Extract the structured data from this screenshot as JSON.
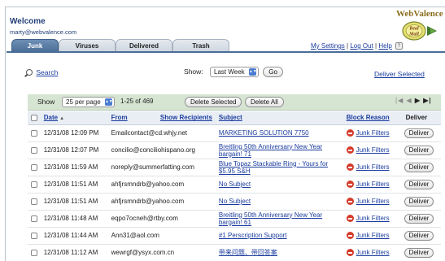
{
  "header": {
    "welcome": "Welcome",
    "email": "marty@webvalence.com",
    "logo_brand": "WebValence",
    "logo_product": "Real Mail"
  },
  "tabs": [
    {
      "label": "Junk",
      "active": true
    },
    {
      "label": "Viruses",
      "active": false
    },
    {
      "label": "Delivered",
      "active": false
    },
    {
      "label": "Trash",
      "active": false
    }
  ],
  "top_links": {
    "settings": "My Settings",
    "logout": "Log Out",
    "help": "Help",
    "help_glyph": "?"
  },
  "search": {
    "label": "Search"
  },
  "show": {
    "label": "Show:",
    "period": "Last Week",
    "go": "Go"
  },
  "deliver_selected": "Deliver Selected",
  "pager": {
    "show_label": "Show",
    "per_page": "25 per page",
    "range": "1-25 of 469",
    "delete_selected": "Delete Selected",
    "delete_all": "Delete All",
    "nav_first": "|◀",
    "nav_prev": "◀",
    "nav_next": "▶",
    "nav_last": "▶|"
  },
  "table": {
    "columns": {
      "date": "Date",
      "from": "From",
      "show_recipients": "Show Recipients",
      "subject": "Subject",
      "block_reason": "Block Reason",
      "deliver": "Deliver"
    },
    "rows": [
      {
        "date": "12/31/08 12:09 PM",
        "from": "Emailcontact@cd.whjy.net",
        "subject": "MARKETING SOLUTION   7750",
        "reason": "Junk Filters",
        "action": "Deliver"
      },
      {
        "date": "12/31/08 12:07 PM",
        "from": "concilio@conciliohispano.org",
        "subject": "Breitling 50th Anniversary New Year bargain! 71",
        "reason": "Junk Filters",
        "action": "Deliver"
      },
      {
        "date": "12/31/08 11:59 AM",
        "from": "noreply@summerfatting.com",
        "subject": "Blue Topaz Stackable Ring - Yours for $5.95 S&H",
        "reason": "Junk Filters",
        "action": "Deliver"
      },
      {
        "date": "12/31/08 11:51 AM",
        "from": "ahfjrsmndrb@yahoo.com",
        "subject": "No Subject",
        "reason": "Junk Filters",
        "action": "Deliver"
      },
      {
        "date": "12/31/08 11:51 AM",
        "from": "ahfjrsmndrb@yahoo.com",
        "subject": "No Subject",
        "reason": "Junk Filters",
        "action": "Deliver"
      },
      {
        "date": "12/31/08 11:48 AM",
        "from": "eqpo7ocneh@rtby.com",
        "subject": "Breitling 50th Anniversary New Year bargain! 61",
        "reason": "Junk Filters",
        "action": "Deliver"
      },
      {
        "date": "12/31/08 11:44 AM",
        "from": "Ann31@aol.com",
        "subject": "#1 Perscription Support",
        "reason": "Junk Filters",
        "action": "Deliver"
      },
      {
        "date": "12/31/08 11:12 AM",
        "from": "wewrgf@ysyx.com.cn",
        "subject": "带来问题、带回答案",
        "reason": "Junk Filters",
        "action": "Deliver"
      }
    ]
  },
  "colors": {
    "tab_active": "#4a6d98",
    "link": "#1a3c9e",
    "pager_bg": "#d6e4d2",
    "block_icon": "#d43a2a"
  }
}
